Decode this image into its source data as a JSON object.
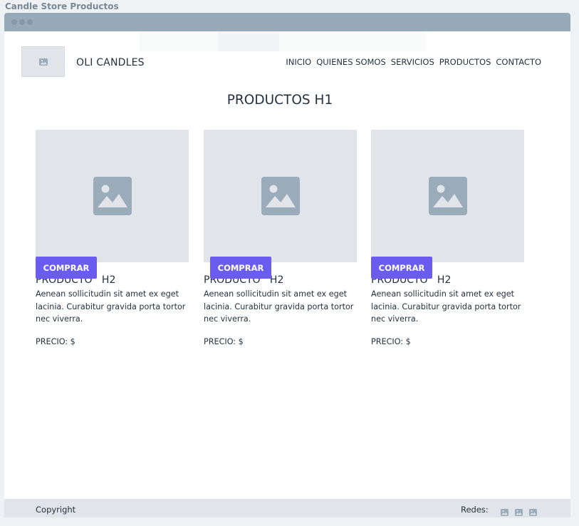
{
  "window": {
    "title": "Candle Store Productos"
  },
  "header": {
    "logo_icon": "image-icon",
    "brand": "OLI CANDLES",
    "nav": [
      "INICIO",
      "QUIENES SOMOS",
      "SERVICIOS",
      "PRODUCTOS",
      "CONTACTO"
    ]
  },
  "main": {
    "title": "PRODUCTOS H1",
    "products": [
      {
        "image_icon": "image-icon",
        "title": "PRODUCTO   H2",
        "description": "Aenean sollicitudin sit amet ex eget lacinia. Curabitur gravida porta tortor nec viverra.",
        "price": "PRECIO: $",
        "button": "COMPRAR"
      },
      {
        "image_icon": "image-icon",
        "title": "PRODUCTO   H2",
        "description": "Aenean sollicitudin sit amet ex eget lacinia. Curabitur gravida porta tortor nec viverra.",
        "price": "PRECIO: $",
        "button": "COMPRAR"
      },
      {
        "image_icon": "image-icon",
        "title": "PRODUCTO   H2",
        "description": "Aenean sollicitudin sit amet ex eget lacinia. Curabitur gravida porta tortor nec viverra.",
        "price": "PRECIO: $",
        "button": "COMPRAR"
      }
    ]
  },
  "footer": {
    "copyright": "Copyright",
    "social_label": "Redes:",
    "social_icons": [
      "image-icon",
      "image-icon",
      "image-icon"
    ]
  },
  "colors": {
    "accent": "#6b5cf0",
    "placeholder": "#e1e5e9",
    "titlebar": "#97aab8"
  }
}
